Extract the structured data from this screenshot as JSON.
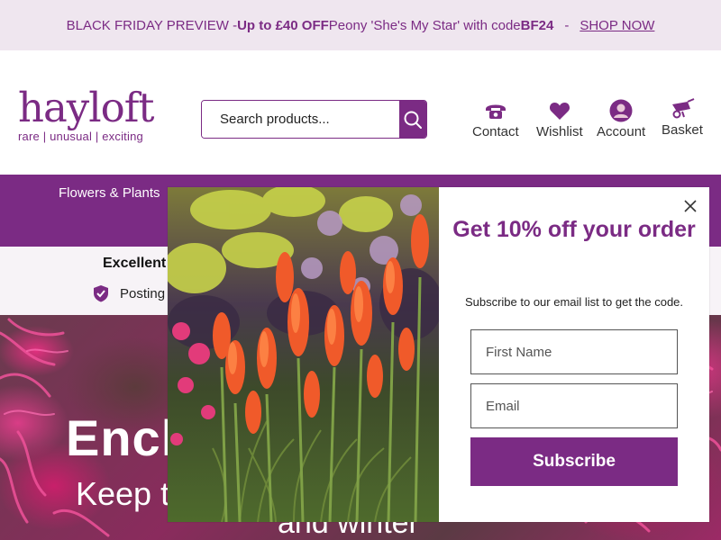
{
  "promo": {
    "prefix": "BLACK FRIDAY PREVIEW - ",
    "offer": "Up to £40 OFF",
    "middle": " Peony 'She's My Star' with code ",
    "code": "BF24",
    "separator": "-",
    "link": "SHOP NOW"
  },
  "header": {
    "logo_word": "hayloft",
    "logo_tagline": "rare | unusual | exciting",
    "search_placeholder": "Search products...",
    "nav": [
      {
        "label": "Contact",
        "icon": "phone-icon"
      },
      {
        "label": "Wishlist",
        "icon": "heart-icon"
      },
      {
        "label": "Account",
        "icon": "account-icon"
      },
      {
        "label": "Basket",
        "icon": "wheelbarrow-icon"
      }
    ]
  },
  "mainnav": {
    "items": [
      "Flowers & Plants"
    ]
  },
  "trust": {
    "rating_text": "Excellent",
    "posting_text": "Posting"
  },
  "hero": {
    "headline": "Encl",
    "subline": "Keep t",
    "subline2": "and winter"
  },
  "popup": {
    "title": "Get 10% off your order",
    "subtitle": "Subscribe to our email list to get the code.",
    "first_name_placeholder": "First Name",
    "email_placeholder": "Email",
    "submit_label": "Subscribe"
  },
  "colors": {
    "brand": "#7b2b84",
    "promo_bg": "#efe6ef",
    "trust_bg": "#f7f3f7"
  }
}
